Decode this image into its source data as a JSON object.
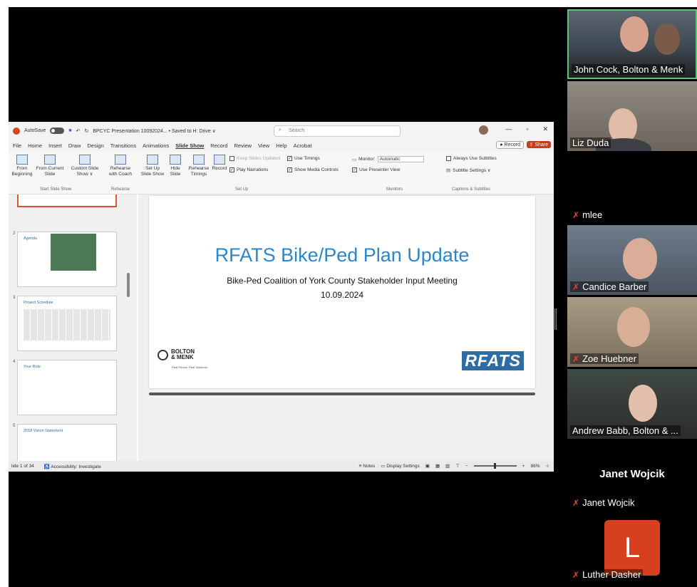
{
  "ppt": {
    "autosave_label": "AutoSave",
    "autosave_state": "Off",
    "doc_title": "BPCYC Presentation 10092024... • Saved to H: Drive ∨",
    "search_placeholder": "Search",
    "menu": [
      "File",
      "Home",
      "Insert",
      "Draw",
      "Design",
      "Transitions",
      "Animations",
      "Slide Show",
      "Record",
      "Review",
      "View",
      "Help",
      "Acrobat"
    ],
    "active_menu": "Slide Show",
    "record_label": "Record",
    "share_label": "Share",
    "ribbon": {
      "from_beginning": "From Beginning",
      "from_current": "From Current Slide",
      "custom_show": "Custom Slide Show ∨",
      "rehearse_coach": "Rehearse with Coach",
      "setup_show": "Set Up Slide Show",
      "hide_slide": "Hide Slide",
      "rehearse_timings": "Rehearse Timings",
      "record": "Record",
      "keep_updated": "Keep Slides Updated",
      "play_narrations": "Play Narrations",
      "use_timings": "Use Timings",
      "show_media": "Show Media Controls",
      "monitor_label": "Monitor:",
      "monitor_value": "Automatic",
      "presenter_view": "Use Presenter View",
      "always_subtitles": "Always Use Subtitles",
      "subtitle_settings": "Subtitle Settings ∨",
      "groups": [
        "Start Slide Show",
        "Rehearse",
        "Set Up",
        "Monitors",
        "Captions & Subtitles"
      ]
    },
    "thumbs": [
      {
        "num": "2",
        "title": "Agenda"
      },
      {
        "num": "3",
        "title": "Project Schedule"
      },
      {
        "num": "4",
        "title": "Your Role"
      },
      {
        "num": "5",
        "title": "2018 Vision Statement"
      }
    ],
    "slide": {
      "title": "RFATS Bike/Ped Plan Update",
      "subtitle": "Bike-Ped Coalition of York County Stakeholder Input Meeting",
      "date": "10.09.2024",
      "bm_logo_line1": "BOLTON",
      "bm_logo_line2": "& MENK",
      "bm_tagline": "Real People. Real Solutions.",
      "rfats_logo": "RFATS"
    },
    "status": {
      "slide_count": "lide 1 of 34",
      "accessibility": "Accessibility: Investigate",
      "notes": "Notes",
      "display_settings": "Display Settings",
      "zoom": "86%"
    }
  },
  "participants": [
    {
      "name": "John Cock, Bolton & Menk",
      "active": true,
      "muted": false,
      "video": true
    },
    {
      "name": "Liz Duda",
      "active": false,
      "muted": false,
      "video": true
    },
    {
      "name": "mlee",
      "active": false,
      "muted": true,
      "video": false
    },
    {
      "name": "Candice Barber",
      "active": false,
      "muted": true,
      "video": true
    },
    {
      "name": "Zoe Huebner",
      "active": false,
      "muted": true,
      "video": true
    },
    {
      "name": "Andrew Babb, Bolton & ...",
      "active": false,
      "muted": false,
      "video": true
    },
    {
      "name": "Janet Wojcik",
      "active": false,
      "muted": true,
      "video": false,
      "display": "Janet Wojcik"
    },
    {
      "name": "Luther Dasher",
      "active": false,
      "muted": true,
      "video": false,
      "initial": "L"
    }
  ],
  "colors": {
    "accent": "#2e86c9",
    "active_border": "#5ec282",
    "mute": "#e8413c",
    "avatar_L": "#d7401e"
  }
}
